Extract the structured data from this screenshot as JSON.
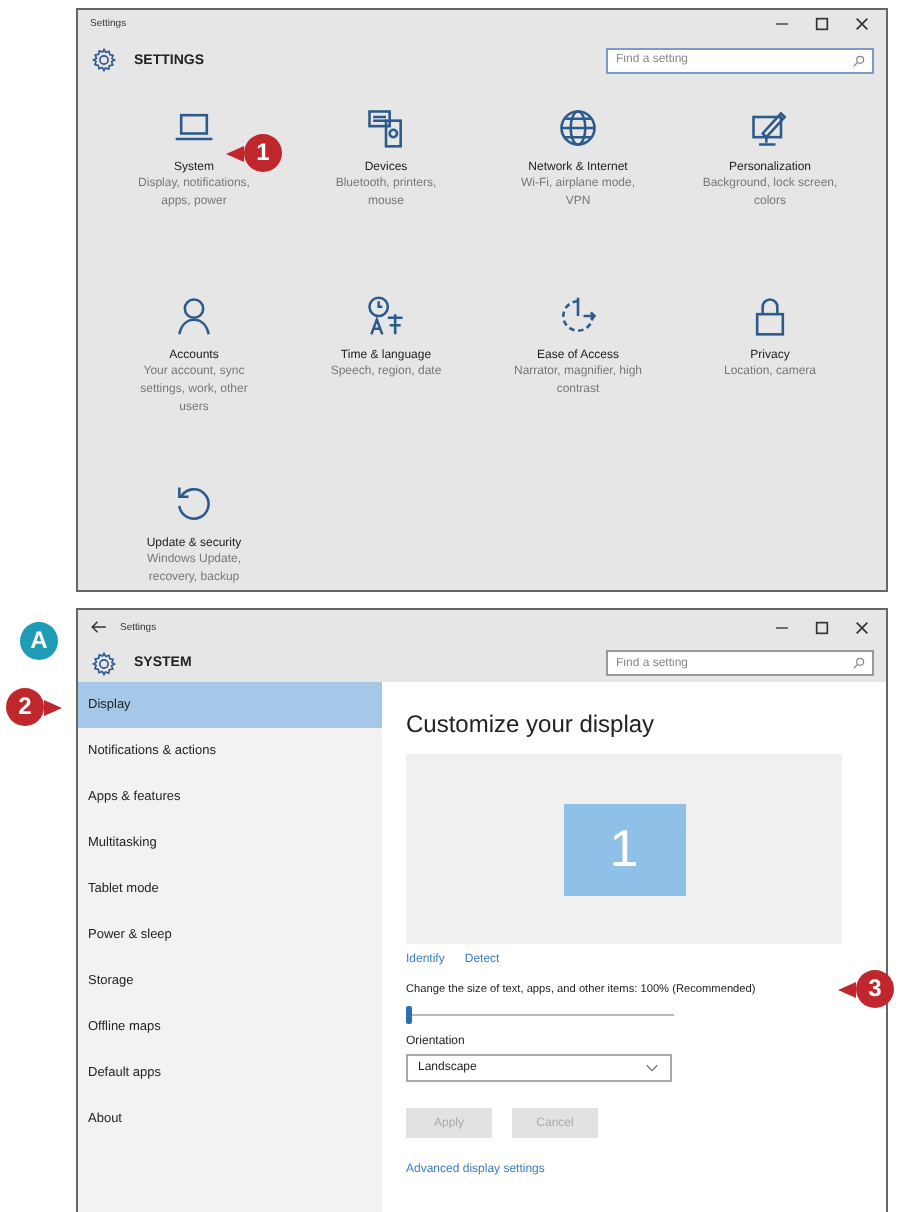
{
  "home_window": {
    "title": "Settings",
    "header": "SETTINGS",
    "search": {
      "placeholder": "Find a setting"
    },
    "categories": [
      {
        "name": "System",
        "description": "Display, notifications, apps, power"
      },
      {
        "name": "Devices",
        "description": "Bluetooth, printers, mouse"
      },
      {
        "name": "Network & Internet",
        "description": "Wi-Fi, airplane mode, VPN"
      },
      {
        "name": "Personalization",
        "description": "Background, lock screen, colors"
      },
      {
        "name": "Accounts",
        "description": "Your account, sync settings, work, other users"
      },
      {
        "name": "Time & language",
        "description": "Speech, region, date"
      },
      {
        "name": "Ease of Access",
        "description": "Narrator, magnifier, high contrast"
      },
      {
        "name": "Privacy",
        "description": "Location, camera"
      },
      {
        "name": "Update & security",
        "description": "Windows Update, recovery, backup"
      }
    ]
  },
  "system_window": {
    "title": "Settings",
    "header": "SYSTEM",
    "search": {
      "placeholder": "Find a setting"
    },
    "sidebar": {
      "items": [
        {
          "label": "Display",
          "selected": true
        },
        {
          "label": "Notifications & actions",
          "selected": false
        },
        {
          "label": "Apps & features",
          "selected": false
        },
        {
          "label": "Multitasking",
          "selected": false
        },
        {
          "label": "Tablet mode",
          "selected": false
        },
        {
          "label": "Power & sleep",
          "selected": false
        },
        {
          "label": "Storage",
          "selected": false
        },
        {
          "label": "Offline maps",
          "selected": false
        },
        {
          "label": "Default apps",
          "selected": false
        },
        {
          "label": "About",
          "selected": false
        }
      ]
    },
    "content": {
      "heading": "Customize your display",
      "monitor_number": "1",
      "links": [
        "Identify",
        "Detect"
      ],
      "scale": {
        "label": "Change the size of text, apps, and other items: 100% (Recommended)",
        "level": 0
      },
      "orientation": {
        "label": "Orientation",
        "value": "Landscape"
      },
      "buttons": [
        {
          "label": "Apply",
          "disabled": true
        },
        {
          "label": "Cancel",
          "disabled": true
        }
      ],
      "advanced_link": "Advanced display settings"
    }
  },
  "callouts": [
    {
      "label": "1",
      "color": "#c0272d"
    },
    {
      "label": "A",
      "color": "#1e9bb5"
    },
    {
      "label": "2",
      "color": "#c0272d"
    },
    {
      "label": "3",
      "color": "#c0272d"
    }
  ]
}
